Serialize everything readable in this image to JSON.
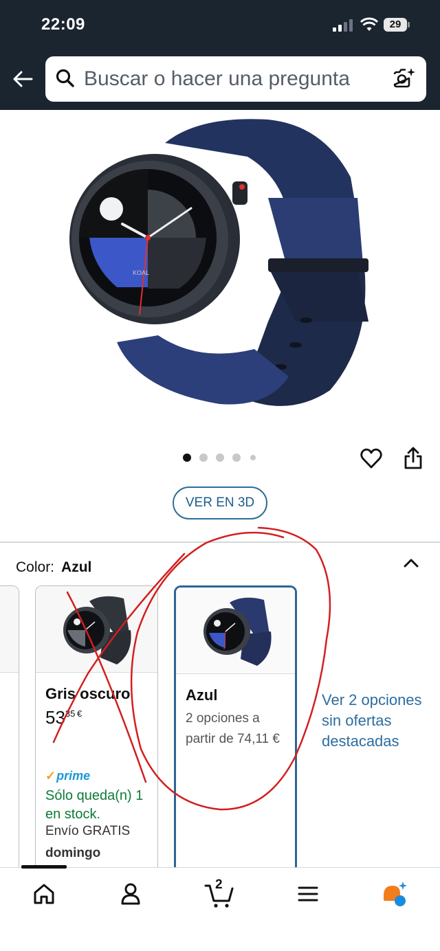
{
  "status_bar": {
    "time": "22:09",
    "battery": "29"
  },
  "search": {
    "placeholder": "Buscar o hacer una pregunta"
  },
  "gallery": {
    "image_count": 5,
    "active_index": 0,
    "view_3d_label": "VER EN 3D"
  },
  "color_selector": {
    "label": "Color:",
    "selected": "Azul",
    "options": [
      {
        "name": "Gris oscuro",
        "price_whole": "53",
        "price_fraction": "35",
        "currency": "€",
        "prime": "prime",
        "stock": "Sólo queda(n) 1 en stock.",
        "shipping": "Envío GRATIS",
        "shipping_day": "domingo"
      },
      {
        "name": "Azul",
        "description": "2 opciones a partir de 74,11 €",
        "selected": true
      }
    ],
    "more_options_link": "Ver 2 opciones sin ofertas destacadas"
  },
  "bottom_nav": {
    "cart_count": "2"
  },
  "colors": {
    "top_bar": "#1b2530",
    "selected_border": "#2e6594",
    "link": "#2d6da0",
    "in_stock": "#0d7a36",
    "prime": "#1a98d5",
    "annotation": "#d21f1f"
  }
}
